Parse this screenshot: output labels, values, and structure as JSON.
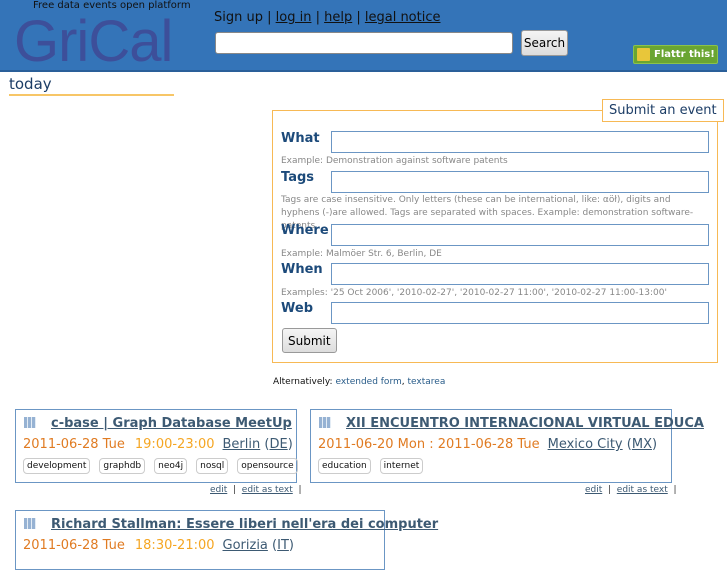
{
  "header": {
    "tagline": "Free data events open platform",
    "logo": "GriCal",
    "links": {
      "signup": "Sign up",
      "login": "log in",
      "help": "help",
      "legal": "legal notice"
    },
    "search_button": "Search",
    "flattr": "Flattr this!"
  },
  "sidebar": {
    "today": "today"
  },
  "form": {
    "tab": "Submit an event",
    "what": "What",
    "what_hint": "Example: Demonstration against software patents",
    "tags": "Tags",
    "tags_hint": "Tags are case insensitive. Only letters (these can be international, like: αöł), digits and hyphens (-)are allowed. Tags are separated with spaces. Example: demonstration software-patents",
    "where": "Where",
    "where_hint": "Example: Malmöer Str. 6, Berlin, DE",
    "when": "When",
    "when_hint": "Examples: '25 Oct 2006', '2010-02-27', '2010-02-27 11:00', '2010-02-27 11:00-13:00'",
    "web": "Web",
    "submit": "Submit",
    "alt_label": "Alternatively:",
    "alt_extended": "extended form",
    "alt_textarea": "textarea"
  },
  "events": [
    {
      "title": "c-base | Graph Database MeetUp",
      "date": "2011-06-28 Tue",
      "time": "19:00-23:00",
      "city": "Berlin",
      "country": "DE",
      "tags": [
        "development",
        "graphdb",
        "neo4j",
        "nosql",
        "opensource"
      ]
    },
    {
      "title": "XII ENCUENTRO INTERNACIONAL VIRTUAL EDUCA",
      "date": "2011-06-20 Mon : 2011-06-28 Tue",
      "time": "",
      "city": "Mexico City",
      "country": "MX",
      "tags": [
        "education",
        "internet"
      ]
    },
    {
      "title": "Richard Stallman: Essere liberi nell'era dei computer",
      "date": "2011-06-28 Tue",
      "time": "18:30-21:00",
      "city": "Gorizia",
      "country": "IT",
      "tags": []
    }
  ],
  "edit_links": {
    "edit": "edit",
    "edit_text": "edit as text",
    "sep": "|"
  }
}
